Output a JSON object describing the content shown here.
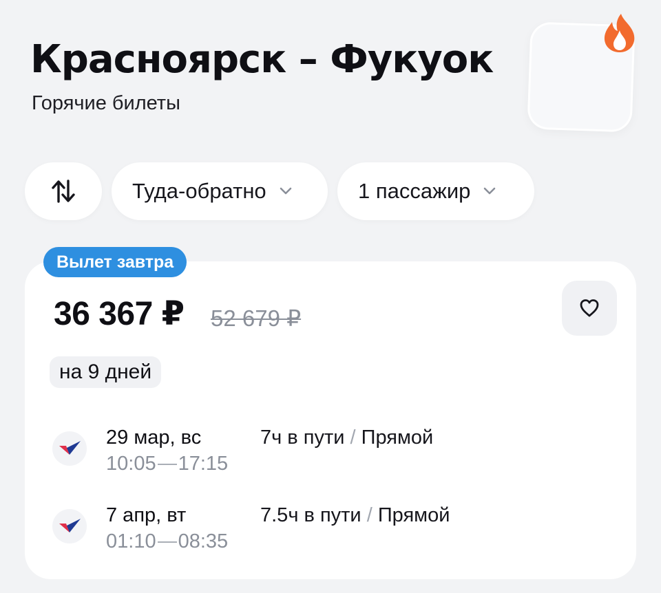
{
  "header": {
    "title": "Красноярск – Фукуок",
    "subtitle": "Горячие билеты"
  },
  "promo": {
    "icon": "fire-icon",
    "accent": "#f26b2e"
  },
  "filters": {
    "swap_icon": "swap-arrows-icon",
    "trip_type": "Туда-обратно",
    "passengers": "1 пассажир"
  },
  "offer": {
    "badge": "Вылет завтра",
    "badge_color": "#2e8fe0",
    "price": "36 367 ₽",
    "old_price": "52 679 ₽",
    "duration": "на 9 дней",
    "favorite_icon": "heart-icon",
    "segments": [
      {
        "date": "29 мар, вс",
        "depart": "10:05",
        "arrive": "17:15",
        "travel": "7ч в пути",
        "sep": "/",
        "type": "Прямой"
      },
      {
        "date": "7 апр, вт",
        "depart": "01:10",
        "arrive": "08:35",
        "travel": "7.5ч в пути",
        "sep": "/",
        "type": "Прямой"
      }
    ]
  }
}
